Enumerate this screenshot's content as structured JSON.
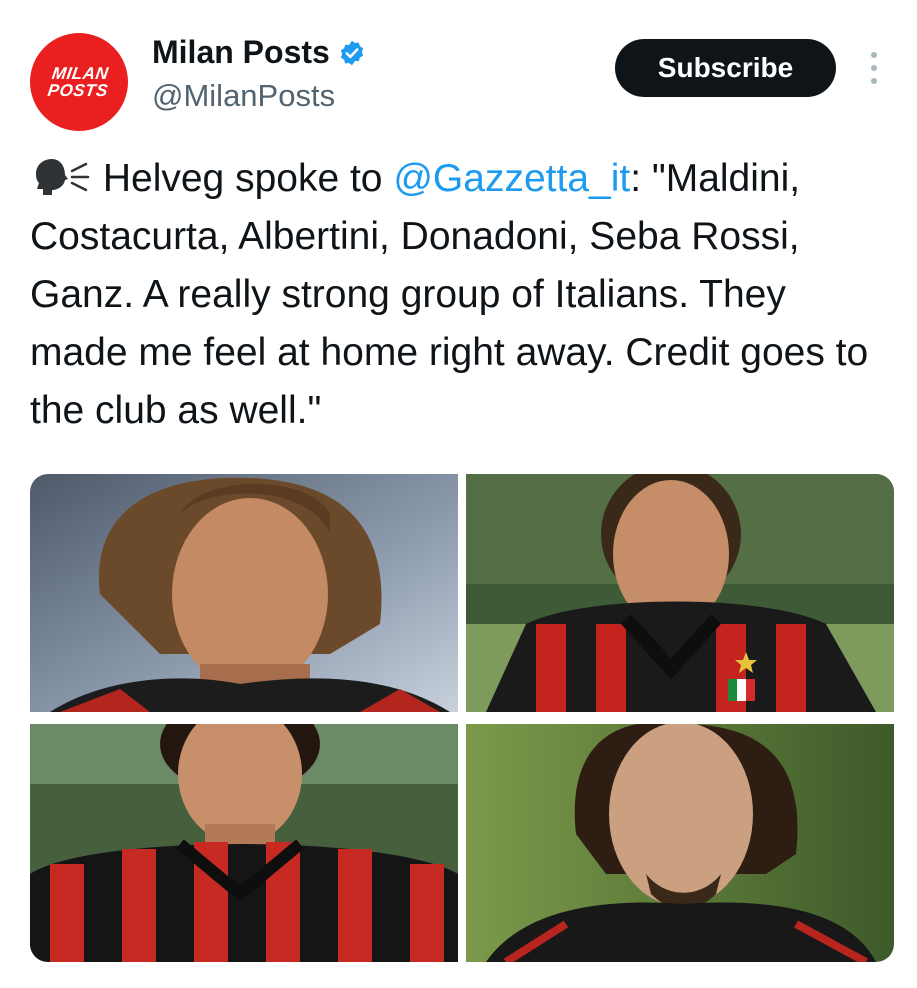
{
  "author": {
    "display_name": "Milan Posts",
    "handle": "@MilanPosts",
    "avatar_text": "MILAN\nPOSTS",
    "verified": true
  },
  "actions": {
    "subscribe_label": "Subscribe"
  },
  "tweet": {
    "text_before": " Helveg spoke to ",
    "mention": "@Gazzetta_it",
    "text_after": ": \"Maldini, Costacurta, Albertini, Donadoni, Seba Rossi, Ganz. A really strong group of Italians. They made me feel at home right away. Credit goes to the club as well.\""
  },
  "colors": {
    "accent_blue": "#1d9bf0",
    "avatar_red": "#e9201f",
    "button_dark": "#0f1419",
    "handle_gray": "#536471"
  },
  "icons": [
    "verified-badge-icon",
    "speaking-head-icon",
    "more-options-icon"
  ]
}
